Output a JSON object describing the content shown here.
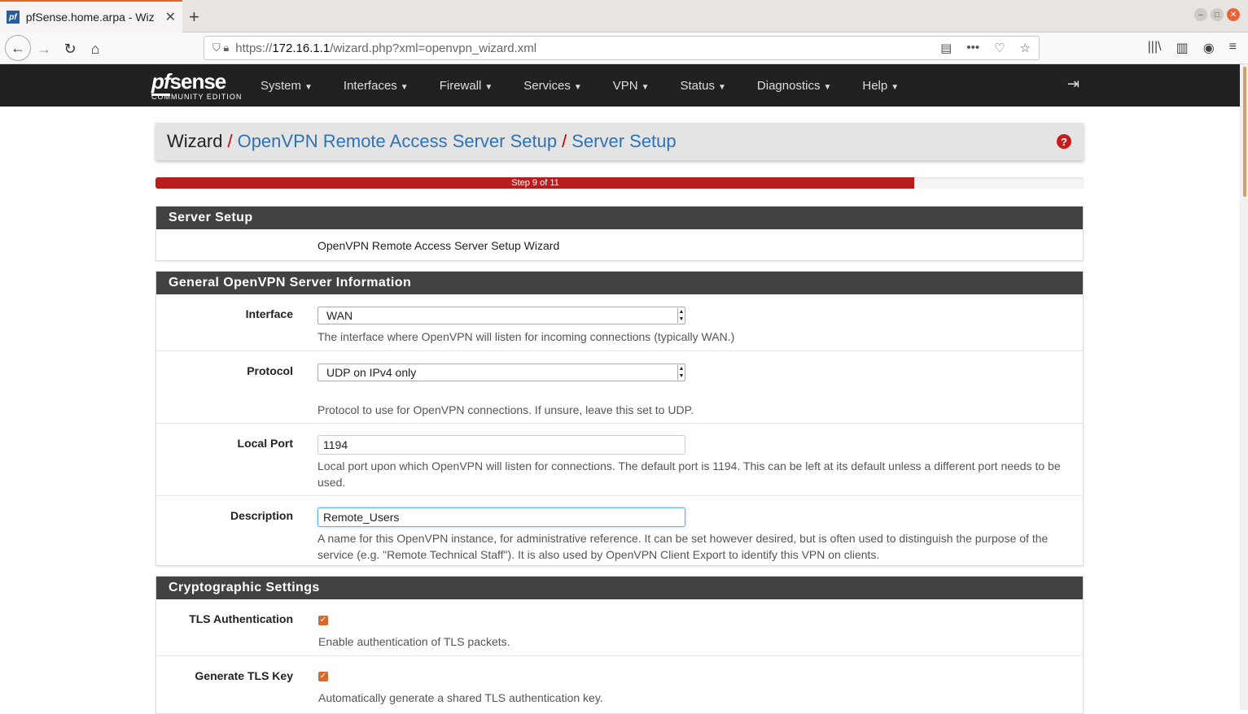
{
  "browser": {
    "tab_title": "pfSense.home.arpa - Wiz",
    "tab_favicon": "pf",
    "url_host": "172.16.1.1",
    "url_prefix": "https://",
    "url_path": "/wizard.php?xml=openvpn_wizard.xml"
  },
  "brand": {
    "logo_text": "sense",
    "logo_prefix": "pf",
    "logo_sub": "COMMUNITY EDITION"
  },
  "menu": [
    "System",
    "Interfaces",
    "Firewall",
    "Services",
    "VPN",
    "Status",
    "Diagnostics",
    "Help"
  ],
  "breadcrumb": {
    "root": "Wizard",
    "sep": "/",
    "link1": "OpenVPN Remote Access Server Setup",
    "link2": "Server Setup"
  },
  "progress": {
    "label": "Step 9 of 11",
    "value": 9,
    "total": 11
  },
  "panels": {
    "server_setup": {
      "title": "Server Setup",
      "text": "OpenVPN Remote Access Server Setup Wizard"
    },
    "general": {
      "title": "General OpenVPN Server Information",
      "interface": {
        "label": "Interface",
        "value": "WAN",
        "help": "The interface where OpenVPN will listen for incoming connections (typically WAN.)"
      },
      "protocol": {
        "label": "Protocol",
        "value": "UDP on IPv4 only",
        "help": "Protocol to use for OpenVPN connections. If unsure, leave this set to UDP."
      },
      "local_port": {
        "label": "Local Port",
        "value": "1194",
        "help": "Local port upon which OpenVPN will listen for connections. The default port is 1194. This can be left at its default unless a different port needs to be used."
      },
      "description": {
        "label": "Description",
        "value": "Remote_Users",
        "help": "A name for this OpenVPN instance, for administrative reference. It can be set however desired, but is often used to distinguish the purpose of the service (e.g. \"Remote Technical Staff\"). It is also used by OpenVPN Client Export to identify this VPN on clients."
      }
    },
    "crypto": {
      "title": "Cryptographic Settings",
      "tls_auth": {
        "label": "TLS Authentication",
        "checked": true,
        "help": "Enable authentication of TLS packets."
      },
      "gen_tls_key": {
        "label": "Generate TLS Key",
        "checked": true,
        "help": "Automatically generate a shared TLS authentication key."
      }
    }
  },
  "colors": {
    "accent": "#b81d1d",
    "link": "#3172b0",
    "header": "#424242",
    "checkbox": "#d9682b"
  }
}
